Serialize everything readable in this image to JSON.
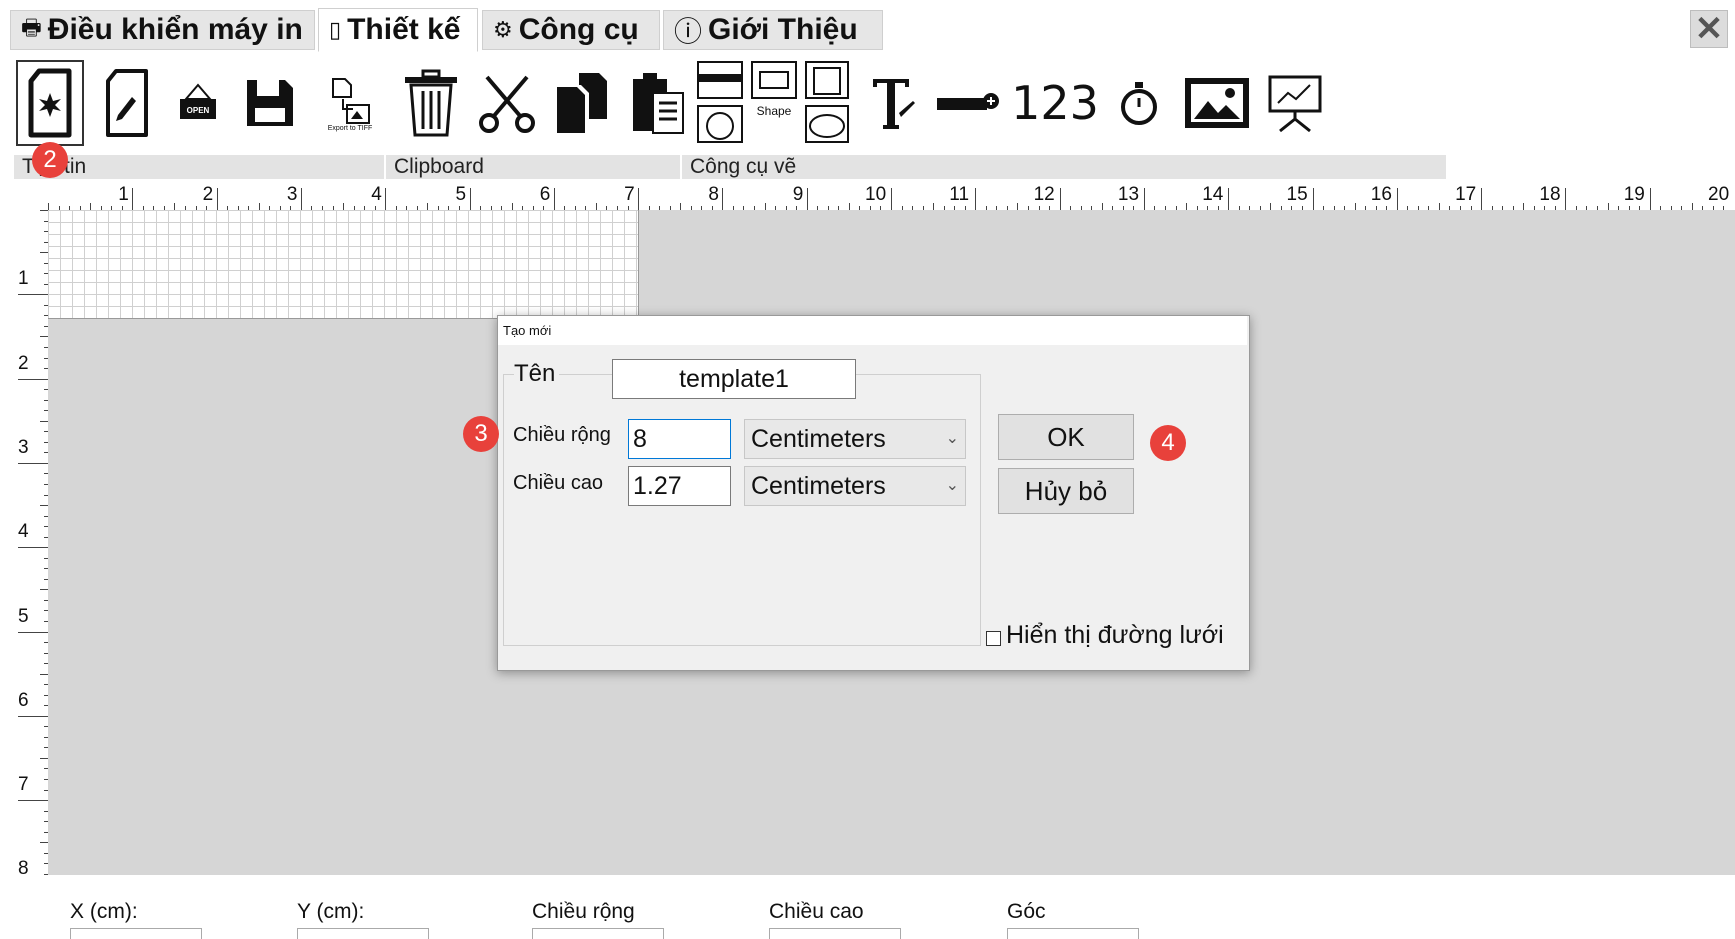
{
  "tabs": [
    {
      "label": "Điều khiển máy in",
      "icon": "printer-icon"
    },
    {
      "label": "Thiết kế",
      "icon": "design-icon"
    },
    {
      "label": "Công cụ",
      "icon": "gears-icon"
    },
    {
      "label": "Giới Thiệu",
      "icon": "info-icon"
    }
  ],
  "close_icon": "close-icon",
  "toolbar": {
    "open_sign_text": "OPEN",
    "export_label": "Export to TIFF",
    "shape_label": "Shape",
    "number_text": "123"
  },
  "groups": {
    "file": "Tệp tin",
    "clipboard": "Clipboard",
    "draw": "Công cụ vẽ"
  },
  "ruler": {
    "h": [
      "1",
      "2",
      "3",
      "4",
      "5",
      "6",
      "7",
      "8",
      "9",
      "10",
      "11",
      "12",
      "13",
      "14",
      "15",
      "16",
      "17",
      "18",
      "19",
      "20"
    ],
    "v": [
      "1",
      "2",
      "3",
      "4",
      "5",
      "6",
      "7",
      "8"
    ]
  },
  "dialog": {
    "title": "Tạo mới",
    "name_label": "Tên",
    "name_value": "template1",
    "width_label": "Chiều rộng",
    "width_value": "8",
    "width_unit": "Centimeters",
    "height_label": "Chiều cao",
    "height_value": "1.27",
    "height_unit": "Centimeters",
    "ok_label": "OK",
    "cancel_label": "Hủy bỏ",
    "grid_label": "Hiển thị đường lưới",
    "grid_checked": false
  },
  "badges": [
    "2",
    "3",
    "4"
  ],
  "badge_color": "#e8413b",
  "bottom": {
    "x_label": "X (cm):",
    "y_label": "Y (cm):",
    "w_label": "Chiều rộng",
    "h_label": "Chiều cao",
    "angle_label": "Góc"
  }
}
